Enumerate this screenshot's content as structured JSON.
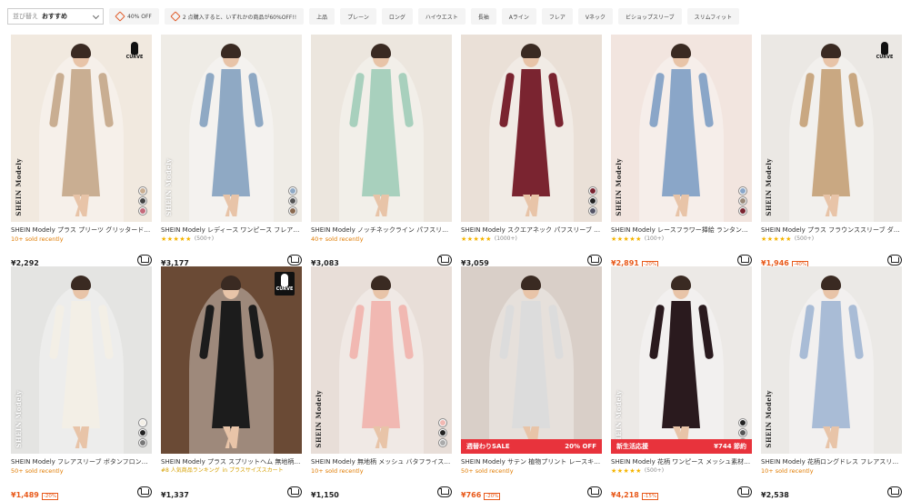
{
  "filter": {
    "sort_label": "並び替え",
    "sort_value": "おすすめ",
    "chips": [
      "40% OFF",
      "2 点購入すると、いずれかの商品が60%OFF!!",
      "上品",
      "プレーン",
      "ロング",
      "ハイウエスト",
      "長袖",
      "Aライン",
      "フレア",
      "Vネック",
      "ビショップスリーブ",
      "スリムフィット"
    ]
  },
  "colors": {
    "sale_price": "#e85a1b",
    "sold": "#e07b00",
    "stars": "#f5b400",
    "banner_red": "#e8333c"
  },
  "products": [
    {
      "title": "SHEIN Modely プラス プリーツ グリッタードレス",
      "sub_type": "sold",
      "sub": "10+ sold recently",
      "price": "¥2,292",
      "sale": false,
      "discount": "",
      "badge": "CURVE",
      "brand": "SHEIN Modely",
      "bg": "#f1e9df",
      "dress": "#c9ae92",
      "skin": "#e8c4a8",
      "swatches": [
        "#c9ae92",
        "#444",
        "#c46a7a"
      ]
    },
    {
      "title": "SHEIN Modely レディース ワンピース フレアスリーブ",
      "sub_type": "rating",
      "stars": "★★★★★",
      "sub": "(500+)",
      "price": "¥3,177",
      "sale": false,
      "discount": "",
      "badge": "",
      "brand": "SHEIN Modely",
      "bg": "#efece6",
      "dress": "#8fa9c4",
      "skin": "#e8c4a8",
      "swatches": [
        "#8fa9c4",
        "#555",
        "#8a6a50"
      ]
    },
    {
      "title": "SHEIN Modely ノッチネックライン パフスリーブ ドレス",
      "sub_type": "sold",
      "sub": "40+ sold recently",
      "price": "¥3,083",
      "sale": false,
      "discount": "",
      "badge": "",
      "brand": "",
      "bg": "#ece6de",
      "dress": "#a8d0bd",
      "skin": "#e8c4a8",
      "swatches": []
    },
    {
      "title": "SHEIN Modely スクエアネック パフスリーブ ドレス",
      "sub_type": "rating",
      "stars": "★★★★★",
      "sub": "(1000+)",
      "price": "¥3,059",
      "sale": false,
      "discount": "",
      "badge": "",
      "brand": "",
      "bg": "#eae0d7",
      "dress": "#7a2430",
      "skin": "#e8c4a8",
      "swatches": [
        "#7a2430",
        "#222",
        "#556"
      ]
    },
    {
      "title": "SHEIN Modely レースフラワー挿絵 ランタンスリーブ ドレス",
      "sub_type": "rating",
      "stars": "★★★★★",
      "sub": "(100+)",
      "price": "¥2,891",
      "sale": true,
      "discount": "-20%",
      "badge": "",
      "brand": "SHEIN Modely",
      "bg": "#f2e5df",
      "dress": "#8aa6c8",
      "skin": "#e8c4a8",
      "swatches": [
        "#8aa6c8",
        "#9a8a7a",
        "#7a2430"
      ]
    },
    {
      "title": "SHEIN Modely プラス フラウンススリーブ ダブルブレスト トレンチコート",
      "sub_type": "rating",
      "stars": "★★★★★",
      "sub": "(500+)",
      "price": "¥1,946",
      "sale": true,
      "discount": "-40%",
      "badge": "CURVE",
      "brand": "SHEIN Modely",
      "bg": "#ebe8e4",
      "dress": "#c9a882",
      "skin": "#e8c4a8",
      "swatches": []
    },
    {
      "title": "SHEIN Modely フレアスリーブ ボタンフロント ブラウス",
      "sub_type": "sold",
      "sub": "50+ sold recently",
      "price": "¥1,489",
      "sale": true,
      "discount": "-20%",
      "badge": "",
      "brand": "SHEIN Modely",
      "bg": "#e4e4e2",
      "dress": "#f3efe6",
      "skin": "#e8c4a8",
      "swatches": [
        "#f3efe6",
        "#222",
        "#777"
      ]
    },
    {
      "title": "SHEIN Modely プラス スプリットヘム 無地柄 スカート",
      "sub_type": "rank",
      "rank": "#8 人気商品ランキング",
      "rank_cat": "in プラスサイズスカート",
      "price": "¥1,337",
      "sale": false,
      "discount": "",
      "badge": "CURVE",
      "brand": "",
      "bg": "#6a4a35",
      "dress": "#1c1c1c",
      "skin": "#e8c4a8",
      "swatches": []
    },
    {
      "title": "SHEIN Modely 無地柄 メッシュ バタフライスリーブ トップス",
      "sub_type": "sold",
      "sub": "10+ sold recently",
      "price": "¥1,150",
      "sale": false,
      "discount": "",
      "badge": "",
      "brand": "SHEIN Modely",
      "bg": "#e8ded8",
      "dress": "#f1b8b2",
      "skin": "#e8c4a8",
      "swatches": [
        "#f1b8b2",
        "#222",
        "#aaa"
      ]
    },
    {
      "title": "SHEIN Modely サテン 植物プリント レースキャミドレス",
      "sub_type": "sold",
      "sub": "50+ sold recently",
      "price": "¥766",
      "sale": true,
      "discount": "-20%",
      "badge": "",
      "brand": "",
      "bg": "#d9cfc8",
      "dress": "#dcdcdc",
      "skin": "#e8c4a8",
      "swatches": [],
      "banner": {
        "left": "週替わりSALE",
        "right": "20% OFF",
        "color": "#e8333c"
      }
    },
    {
      "title": "SHEIN Modely 花柄 ワンピース メッシュ素材 ランタンスリーブ",
      "sub_type": "rating",
      "stars": "★★★★★",
      "sub": "(500+)",
      "price": "¥4,218",
      "sale": true,
      "discount": "-15%",
      "badge": "",
      "brand": "SHEIN Modely",
      "bg": "#ece9e6",
      "dress": "#2a1a1e",
      "skin": "#e8c4a8",
      "swatches": [
        "#222",
        "#555",
        "#888"
      ],
      "banner": {
        "left": "新生活応援",
        "right": "¥744 節約",
        "color": "#e8333c"
      }
    },
    {
      "title": "SHEIN Modely 花柄ロングドレス フレアスリーブ",
      "sub_type": "sold",
      "sub": "10+ sold recently",
      "price": "¥2,538",
      "sale": false,
      "discount": "",
      "badge": "",
      "brand": "SHEIN Modely",
      "bg": "#ebe9e6",
      "dress": "#a9bcd6",
      "skin": "#e8c4a8",
      "swatches": []
    }
  ]
}
